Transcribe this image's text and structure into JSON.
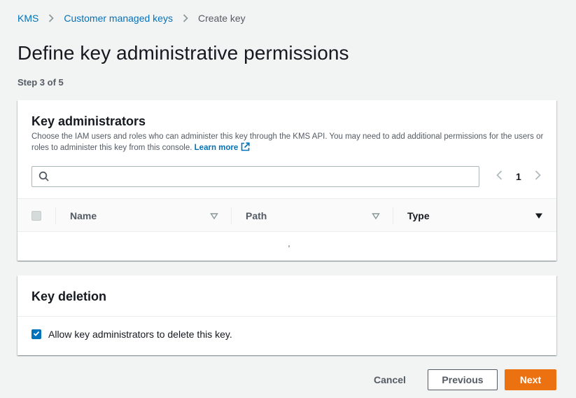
{
  "breadcrumb": {
    "items": [
      "KMS",
      "Customer managed keys"
    ],
    "current": "Create key"
  },
  "page": {
    "title": "Define key administrative permissions",
    "step": "Step 3 of 5"
  },
  "key_administrators": {
    "title": "Key administrators",
    "description": "Choose the IAM users and roles who can administer this key through the KMS API. You may need to add additional permissions for the users or roles to administer this key from this console.",
    "learn_more": "Learn more",
    "search": {
      "value": "",
      "placeholder": ""
    },
    "pagination": {
      "current_page": "1"
    },
    "table": {
      "columns": [
        "Name",
        "Path",
        "Type"
      ],
      "rows": []
    }
  },
  "key_deletion": {
    "title": "Key deletion",
    "checkbox_label": "Allow key administrators to delete this key.",
    "checked": true
  },
  "footer": {
    "cancel": "Cancel",
    "previous": "Previous",
    "next": "Next"
  },
  "colors": {
    "link": "#0073bb",
    "primary_button": "#ec7211",
    "background": "#f2f3f3"
  }
}
